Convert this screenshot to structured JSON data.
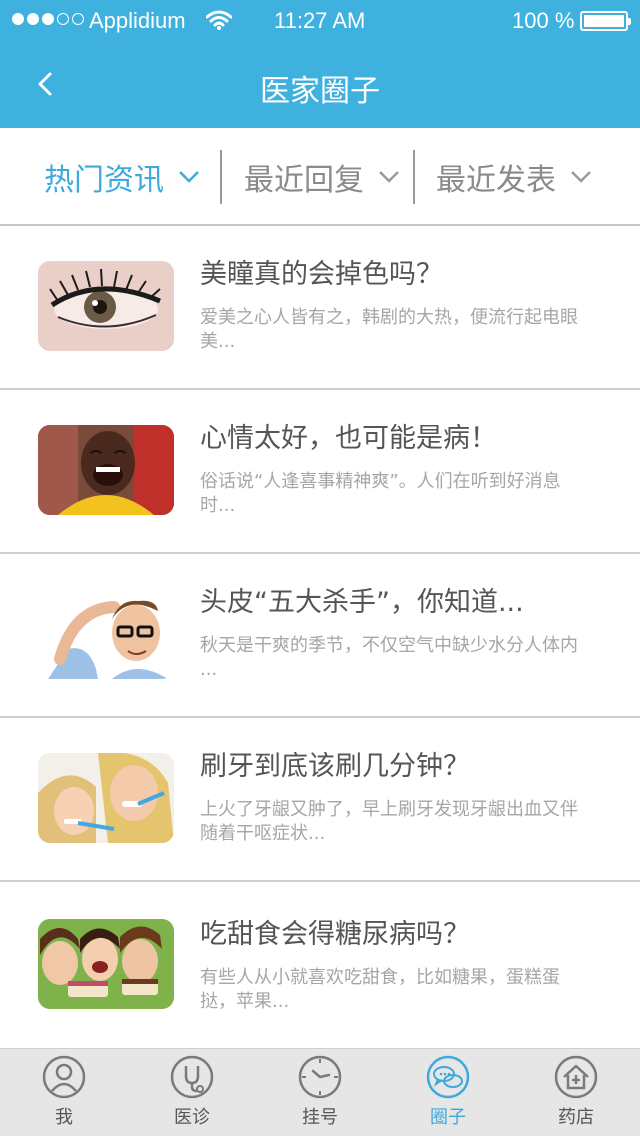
{
  "status_bar": {
    "carrier": "Applidium",
    "time": "11:27 AM",
    "battery": "100 %",
    "battery_level": 1.0
  },
  "nav": {
    "title": "医家圈子",
    "back_icon": "chevron-left-icon"
  },
  "tabs": [
    {
      "label": "热门资讯",
      "active": true
    },
    {
      "label": "最近回复",
      "active": false
    },
    {
      "label": "最近发表",
      "active": false
    }
  ],
  "articles": [
    {
      "title": "美瞳真的会掉色吗？",
      "summary": "爱美之心人皆有之，韩剧的大热，便流行起电眼美...",
      "image": "eye-closeup"
    },
    {
      "title": "心情太好，也可能是病！",
      "summary": "俗话说“人逢喜事精神爽”。人们在听到好消息时...",
      "image": "laughing-man"
    },
    {
      "title": "头皮“五大杀手”，你知道...",
      "summary": "秋天是干爽的季节，不仅空气中缺少水分人体内 ...",
      "image": "man-scratching-head"
    },
    {
      "title": "刷牙到底该刷几分钟？",
      "summary": "上火了牙龈又肿了，早上刷牙发现牙龈出血又伴随着干呕症状...",
      "image": "mother-child-brushing"
    },
    {
      "title": "吃甜食会得糖尿病吗？",
      "summary": "有些人从小就喜欢吃甜食，比如糖果，蛋糕蛋挞，苹果...",
      "image": "women-eating-cake"
    }
  ],
  "tabbar": [
    {
      "label": "我",
      "icon": "person-icon",
      "active": false
    },
    {
      "label": "医诊",
      "icon": "stethoscope-icon",
      "active": false
    },
    {
      "label": "挂号",
      "icon": "clock-icon",
      "active": false
    },
    {
      "label": "圈子",
      "icon": "chat-bubbles-icon",
      "active": true
    },
    {
      "label": "药店",
      "icon": "pharmacy-house-icon",
      "active": false
    }
  ],
  "colors": {
    "header_bg": "#3fb1df",
    "accent": "#3fa9dc",
    "tabbar_bg": "#e6e6e6"
  }
}
